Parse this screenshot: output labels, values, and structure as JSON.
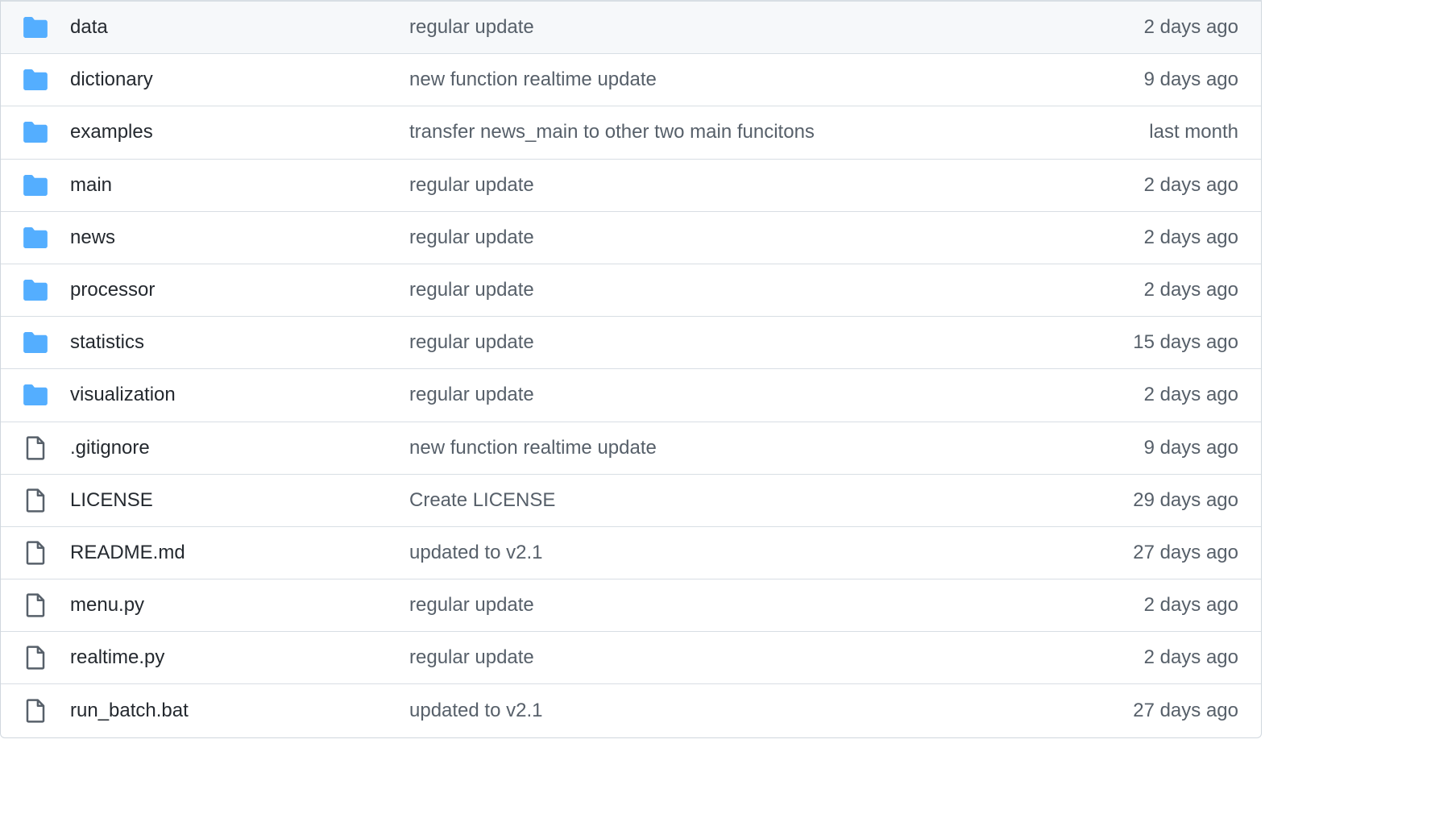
{
  "colors": {
    "folder_icon": "#54aeff",
    "file_icon": "#57606a",
    "name_text": "#24292f",
    "secondary_text": "#57606a",
    "border": "#d8dee4",
    "highlight_row": "#f6f8fa"
  },
  "files": [
    {
      "type": "dir",
      "icon": "folder-icon",
      "name": "data",
      "commit": "regular update",
      "age": "2 days ago"
    },
    {
      "type": "dir",
      "icon": "folder-icon",
      "name": "dictionary",
      "commit": "new function realtime update",
      "age": "9 days ago"
    },
    {
      "type": "dir",
      "icon": "folder-icon",
      "name": "examples",
      "commit": "transfer news_main to other two main funcitons",
      "age": "last month"
    },
    {
      "type": "dir",
      "icon": "folder-icon",
      "name": "main",
      "commit": "regular update",
      "age": "2 days ago"
    },
    {
      "type": "dir",
      "icon": "folder-icon",
      "name": "news",
      "commit": "regular update",
      "age": "2 days ago"
    },
    {
      "type": "dir",
      "icon": "folder-icon",
      "name": "processor",
      "commit": "regular update",
      "age": "2 days ago"
    },
    {
      "type": "dir",
      "icon": "folder-icon",
      "name": "statistics",
      "commit": "regular update",
      "age": "15 days ago"
    },
    {
      "type": "dir",
      "icon": "folder-icon",
      "name": "visualization",
      "commit": "regular update",
      "age": "2 days ago"
    },
    {
      "type": "file",
      "icon": "file-icon",
      "name": ".gitignore",
      "commit": "new function realtime update",
      "age": "9 days ago"
    },
    {
      "type": "file",
      "icon": "file-icon",
      "name": "LICENSE",
      "commit": "Create LICENSE",
      "age": "29 days ago"
    },
    {
      "type": "file",
      "icon": "file-icon",
      "name": "README.md",
      "commit": "updated to v2.1",
      "age": "27 days ago"
    },
    {
      "type": "file",
      "icon": "file-icon",
      "name": "menu.py",
      "commit": "regular update",
      "age": "2 days ago"
    },
    {
      "type": "file",
      "icon": "file-icon",
      "name": "realtime.py",
      "commit": "regular update",
      "age": "2 days ago"
    },
    {
      "type": "file",
      "icon": "file-icon",
      "name": "run_batch.bat",
      "commit": "updated to v2.1",
      "age": "27 days ago"
    }
  ]
}
